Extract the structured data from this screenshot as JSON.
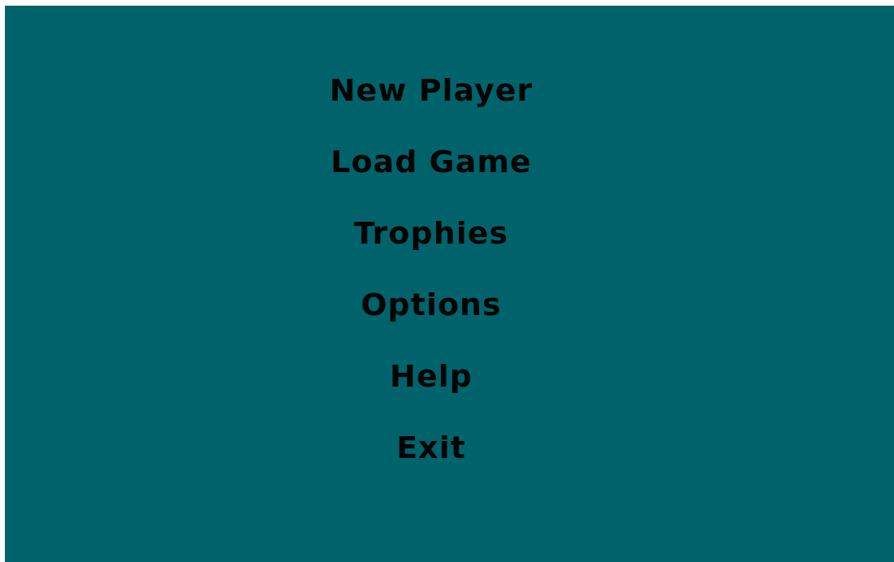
{
  "menu": [
    {
      "label": "New Player"
    },
    {
      "label": "Load Game"
    },
    {
      "label": "Trophies"
    },
    {
      "label": "Options"
    },
    {
      "label": "Help"
    },
    {
      "label": "Exit"
    }
  ]
}
